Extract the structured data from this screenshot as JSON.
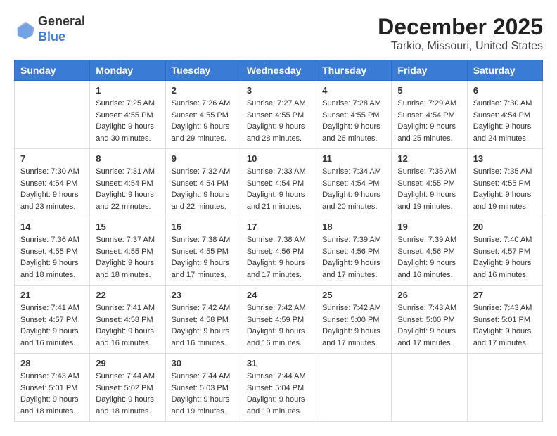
{
  "logo": {
    "general": "General",
    "blue": "Blue"
  },
  "title": "December 2025",
  "subtitle": "Tarkio, Missouri, United States",
  "days_of_week": [
    "Sunday",
    "Monday",
    "Tuesday",
    "Wednesday",
    "Thursday",
    "Friday",
    "Saturday"
  ],
  "weeks": [
    [
      {
        "day": "",
        "info": ""
      },
      {
        "day": "1",
        "info": "Sunrise: 7:25 AM\nSunset: 4:55 PM\nDaylight: 9 hours\nand 30 minutes."
      },
      {
        "day": "2",
        "info": "Sunrise: 7:26 AM\nSunset: 4:55 PM\nDaylight: 9 hours\nand 29 minutes."
      },
      {
        "day": "3",
        "info": "Sunrise: 7:27 AM\nSunset: 4:55 PM\nDaylight: 9 hours\nand 28 minutes."
      },
      {
        "day": "4",
        "info": "Sunrise: 7:28 AM\nSunset: 4:55 PM\nDaylight: 9 hours\nand 26 minutes."
      },
      {
        "day": "5",
        "info": "Sunrise: 7:29 AM\nSunset: 4:54 PM\nDaylight: 9 hours\nand 25 minutes."
      },
      {
        "day": "6",
        "info": "Sunrise: 7:30 AM\nSunset: 4:54 PM\nDaylight: 9 hours\nand 24 minutes."
      }
    ],
    [
      {
        "day": "7",
        "info": "Sunrise: 7:30 AM\nSunset: 4:54 PM\nDaylight: 9 hours\nand 23 minutes."
      },
      {
        "day": "8",
        "info": "Sunrise: 7:31 AM\nSunset: 4:54 PM\nDaylight: 9 hours\nand 22 minutes."
      },
      {
        "day": "9",
        "info": "Sunrise: 7:32 AM\nSunset: 4:54 PM\nDaylight: 9 hours\nand 22 minutes."
      },
      {
        "day": "10",
        "info": "Sunrise: 7:33 AM\nSunset: 4:54 PM\nDaylight: 9 hours\nand 21 minutes."
      },
      {
        "day": "11",
        "info": "Sunrise: 7:34 AM\nSunset: 4:54 PM\nDaylight: 9 hours\nand 20 minutes."
      },
      {
        "day": "12",
        "info": "Sunrise: 7:35 AM\nSunset: 4:55 PM\nDaylight: 9 hours\nand 19 minutes."
      },
      {
        "day": "13",
        "info": "Sunrise: 7:35 AM\nSunset: 4:55 PM\nDaylight: 9 hours\nand 19 minutes."
      }
    ],
    [
      {
        "day": "14",
        "info": "Sunrise: 7:36 AM\nSunset: 4:55 PM\nDaylight: 9 hours\nand 18 minutes."
      },
      {
        "day": "15",
        "info": "Sunrise: 7:37 AM\nSunset: 4:55 PM\nDaylight: 9 hours\nand 18 minutes."
      },
      {
        "day": "16",
        "info": "Sunrise: 7:38 AM\nSunset: 4:55 PM\nDaylight: 9 hours\nand 17 minutes."
      },
      {
        "day": "17",
        "info": "Sunrise: 7:38 AM\nSunset: 4:56 PM\nDaylight: 9 hours\nand 17 minutes."
      },
      {
        "day": "18",
        "info": "Sunrise: 7:39 AM\nSunset: 4:56 PM\nDaylight: 9 hours\nand 17 minutes."
      },
      {
        "day": "19",
        "info": "Sunrise: 7:39 AM\nSunset: 4:56 PM\nDaylight: 9 hours\nand 16 minutes."
      },
      {
        "day": "20",
        "info": "Sunrise: 7:40 AM\nSunset: 4:57 PM\nDaylight: 9 hours\nand 16 minutes."
      }
    ],
    [
      {
        "day": "21",
        "info": "Sunrise: 7:41 AM\nSunset: 4:57 PM\nDaylight: 9 hours\nand 16 minutes."
      },
      {
        "day": "22",
        "info": "Sunrise: 7:41 AM\nSunset: 4:58 PM\nDaylight: 9 hours\nand 16 minutes."
      },
      {
        "day": "23",
        "info": "Sunrise: 7:42 AM\nSunset: 4:58 PM\nDaylight: 9 hours\nand 16 minutes."
      },
      {
        "day": "24",
        "info": "Sunrise: 7:42 AM\nSunset: 4:59 PM\nDaylight: 9 hours\nand 16 minutes."
      },
      {
        "day": "25",
        "info": "Sunrise: 7:42 AM\nSunset: 5:00 PM\nDaylight: 9 hours\nand 17 minutes."
      },
      {
        "day": "26",
        "info": "Sunrise: 7:43 AM\nSunset: 5:00 PM\nDaylight: 9 hours\nand 17 minutes."
      },
      {
        "day": "27",
        "info": "Sunrise: 7:43 AM\nSunset: 5:01 PM\nDaylight: 9 hours\nand 17 minutes."
      }
    ],
    [
      {
        "day": "28",
        "info": "Sunrise: 7:43 AM\nSunset: 5:01 PM\nDaylight: 9 hours\nand 18 minutes."
      },
      {
        "day": "29",
        "info": "Sunrise: 7:44 AM\nSunset: 5:02 PM\nDaylight: 9 hours\nand 18 minutes."
      },
      {
        "day": "30",
        "info": "Sunrise: 7:44 AM\nSunset: 5:03 PM\nDaylight: 9 hours\nand 19 minutes."
      },
      {
        "day": "31",
        "info": "Sunrise: 7:44 AM\nSunset: 5:04 PM\nDaylight: 9 hours\nand 19 minutes."
      },
      {
        "day": "",
        "info": ""
      },
      {
        "day": "",
        "info": ""
      },
      {
        "day": "",
        "info": ""
      }
    ]
  ]
}
